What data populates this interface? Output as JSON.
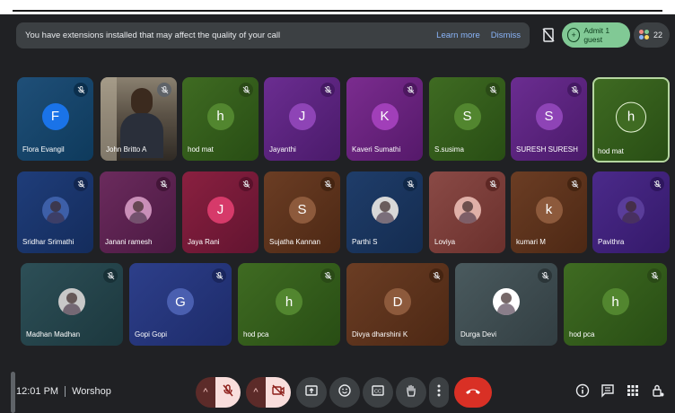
{
  "banner": {
    "message": "You have extensions installed that may affect the quality of your call",
    "learn_more": "Learn more",
    "dismiss": "Dismiss"
  },
  "admit": {
    "label": "Admit 1 guest"
  },
  "people_count": "22",
  "participants": [
    {
      "name": "Flora Evangil",
      "initial": "F",
      "muted": true
    },
    {
      "name": "John Britto A",
      "initial": "",
      "muted": true,
      "video": true
    },
    {
      "name": "hod mat",
      "initial": "h",
      "muted": true
    },
    {
      "name": "Jayanthi",
      "initial": "J",
      "muted": true
    },
    {
      "name": "Kaveri Sumathi",
      "initial": "K",
      "muted": true
    },
    {
      "name": "S.susima",
      "initial": "S",
      "muted": true
    },
    {
      "name": "SURESH SURESH",
      "initial": "S",
      "muted": true
    },
    {
      "name": "hod mat",
      "initial": "h",
      "muted": false,
      "speaking": true
    },
    {
      "name": "Sridhar Srimathi",
      "initial": "",
      "muted": true,
      "photo": true
    },
    {
      "name": "Janani ramesh",
      "initial": "",
      "muted": true,
      "photo": true
    },
    {
      "name": "Jaya Rani",
      "initial": "J",
      "muted": true
    },
    {
      "name": "Sujatha Kannan",
      "initial": "S",
      "muted": true
    },
    {
      "name": "Parthi S",
      "initial": "",
      "muted": true,
      "photo": true
    },
    {
      "name": "Loviya",
      "initial": "",
      "muted": true,
      "photo": true
    },
    {
      "name": "kumari M",
      "initial": "k",
      "muted": true
    },
    {
      "name": "Pavithra",
      "initial": "",
      "muted": true,
      "photo": true
    },
    {
      "name": "Madhan Madhan",
      "initial": "",
      "muted": true,
      "photo": true
    },
    {
      "name": "Gopi Gopi",
      "initial": "G",
      "muted": true
    },
    {
      "name": "hod pca",
      "initial": "h",
      "muted": true
    },
    {
      "name": "Divya dharshini K",
      "initial": "D",
      "muted": true
    },
    {
      "name": "Durga Devi",
      "initial": "",
      "muted": true,
      "photo": true
    },
    {
      "name": "hod pca",
      "initial": "h",
      "muted": true
    }
  ],
  "bottom": {
    "time": "12:01 PM",
    "meeting_name": "Worshop"
  },
  "icons": {
    "mic": "mic-off-icon",
    "camera": "camera-off-icon",
    "present": "present-screen-icon",
    "emoji": "emoji-icon",
    "captions": "captions-icon",
    "hand": "raise-hand-icon",
    "more": "more-options-icon",
    "hangup": "hang-up-icon",
    "info": "info-icon",
    "chat": "chat-icon",
    "activities": "activities-icon",
    "host": "host-controls-icon"
  },
  "colors": {
    "background": "#202124",
    "admit": "#81c995",
    "hangup": "#d93025",
    "link": "#8ab4f8"
  }
}
